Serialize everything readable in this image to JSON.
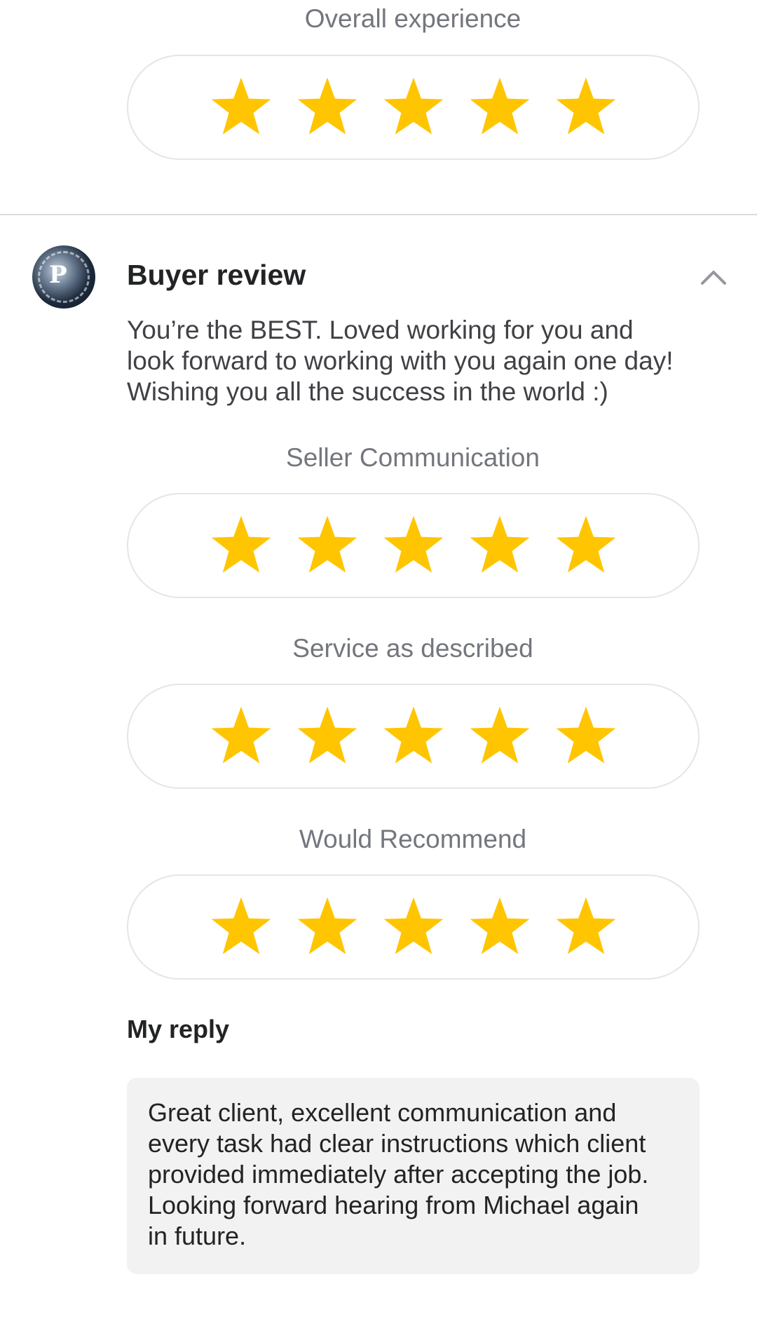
{
  "overall": {
    "title": "Overall experience",
    "rating": 5,
    "max": 5
  },
  "buyer_review": {
    "title": "Buyer review",
    "text_lines": [
      "You’re the BEST. Loved working for you and",
      "look forward to working with you again one day!",
      "Wishing you all the success in the world :)"
    ],
    "avatar_letter": "P",
    "collapse_icon": "chevron-up-icon"
  },
  "ratings": [
    {
      "title": "Seller Communication",
      "rating": 5,
      "max": 5
    },
    {
      "title": "Service as described",
      "rating": 5,
      "max": 5
    },
    {
      "title": "Would Recommend",
      "rating": 5,
      "max": 5
    }
  ],
  "reply": {
    "title": "My reply",
    "text_lines": [
      "Great client, excellent communication and",
      "every task had clear instructions which client",
      "provided immediately after accepting the job.",
      "Looking forward hearing from Michael again",
      "in future."
    ]
  },
  "colors": {
    "star": "#FFC500",
    "star_outline": "#E4E5E7"
  },
  "icons": {
    "star": "star-icon",
    "chevron": "chevron-up-icon"
  }
}
